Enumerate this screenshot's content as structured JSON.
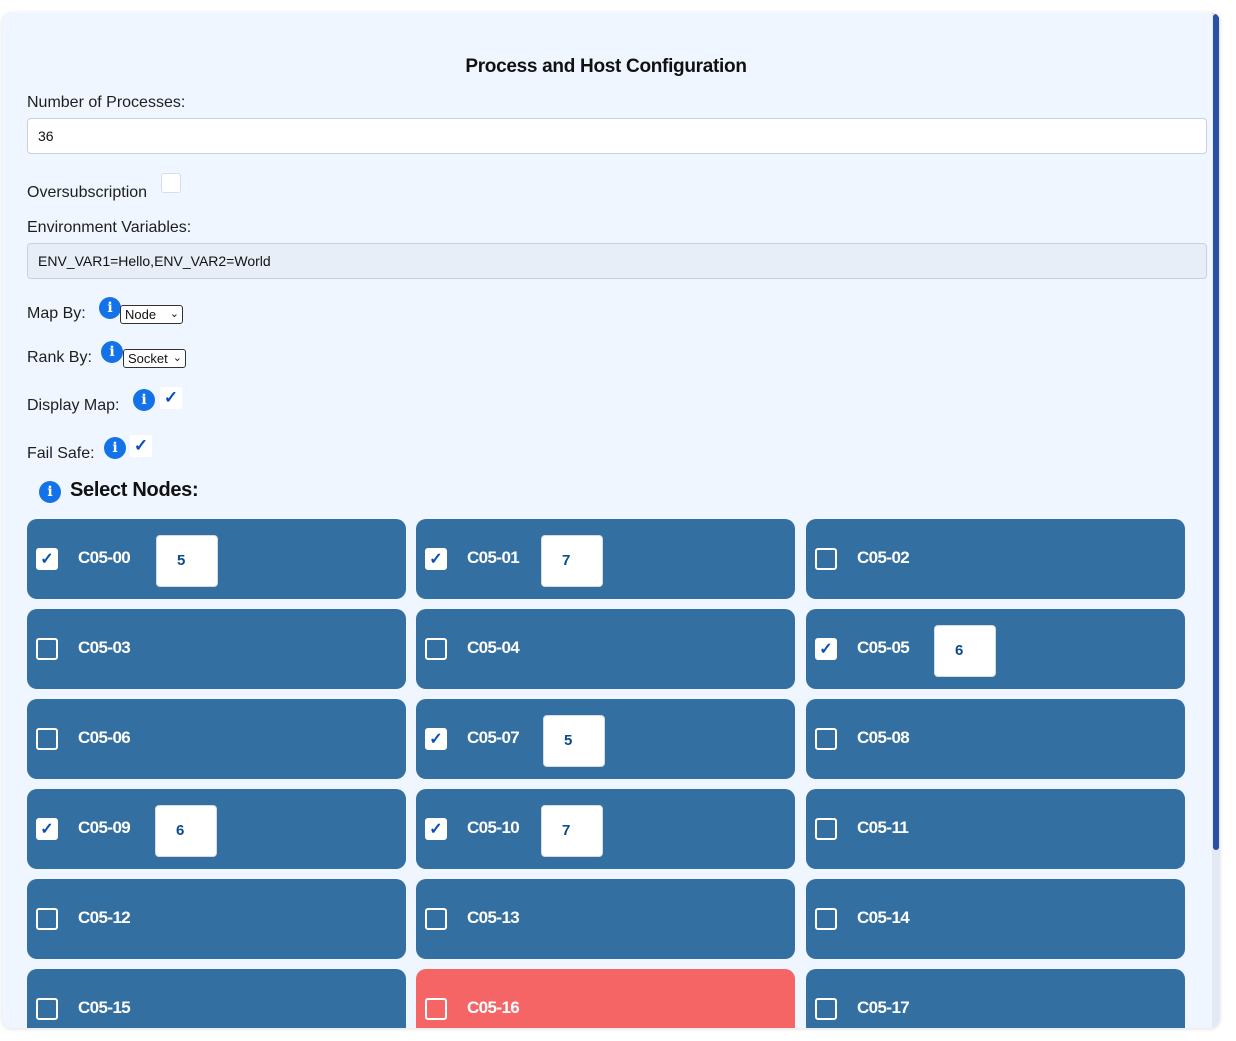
{
  "form": {
    "title": "Process and Host Configuration",
    "num_processes_label": "Number of Processes:",
    "num_processes_value": "36",
    "oversubscription_label": "Oversubscription",
    "env_label": "Environment Variables:",
    "env_value": "ENV_VAR1=Hello,ENV_VAR2=World",
    "map_by_label": "Map By:",
    "map_by_value": "Node",
    "rank_by_label": "Rank By:",
    "rank_by_value": "Socket",
    "display_map_label": "Display Map:",
    "fail_safe_label": "Fail Safe:",
    "info_glyph": "i",
    "tick_glyph": "✓",
    "chevron_glyph": "⌄"
  },
  "nodes_section": {
    "title": "Select Nodes:"
  },
  "nodes": [
    {
      "name": "C05-00",
      "checked": true,
      "qty": "5"
    },
    {
      "name": "C05-01",
      "checked": true,
      "qty": "7"
    },
    {
      "name": "C05-02",
      "checked": false
    },
    {
      "name": "C05-03",
      "checked": false
    },
    {
      "name": "C05-04",
      "checked": false
    },
    {
      "name": "C05-05",
      "checked": true,
      "qty": "6"
    },
    {
      "name": "C05-06",
      "checked": false
    },
    {
      "name": "C05-07",
      "checked": true,
      "qty": "5"
    },
    {
      "name": "C05-08",
      "checked": false
    },
    {
      "name": "C05-09",
      "checked": true,
      "qty": "6"
    },
    {
      "name": "C05-10",
      "checked": true,
      "qty": "7"
    },
    {
      "name": "C05-11",
      "checked": false
    },
    {
      "name": "C05-12",
      "checked": false
    },
    {
      "name": "C05-13",
      "checked": false
    },
    {
      "name": "C05-14",
      "checked": false
    },
    {
      "name": "C05-15",
      "checked": false
    },
    {
      "name": "C05-16",
      "checked": false,
      "status": "error"
    },
    {
      "name": "C05-17",
      "checked": false
    }
  ],
  "colors": {
    "card": "#336fa0",
    "card_error": "#f56565",
    "info": "#1472e8",
    "panel": "#eff6ff"
  }
}
